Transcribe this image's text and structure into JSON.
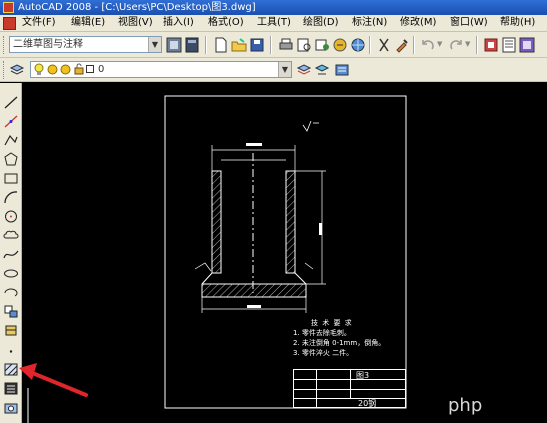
{
  "window": {
    "title": "AutoCAD 2008 - [C:\\Users\\PC\\Desktop\\图3.dwg]"
  },
  "menu": [
    "文件(F)",
    "编辑(E)",
    "视图(V)",
    "插入(I)",
    "格式(O)",
    "工具(T)",
    "绘图(D)",
    "标注(N)",
    "修改(M)",
    "窗口(W)",
    "帮助(H)"
  ],
  "toolbar": {
    "workspace": "二维草图与注释",
    "layer_value": "0"
  },
  "drawing": {
    "notes_heading": "技 术 要 求",
    "notes": [
      "1.  零件去除毛刺。",
      "2.  未注倒角 0-1mm，倒角。",
      "3.  零件淬火 二件。"
    ],
    "title_block": {
      "sheet_label": "图3",
      "material": "20钢"
    }
  },
  "watermark": "php"
}
